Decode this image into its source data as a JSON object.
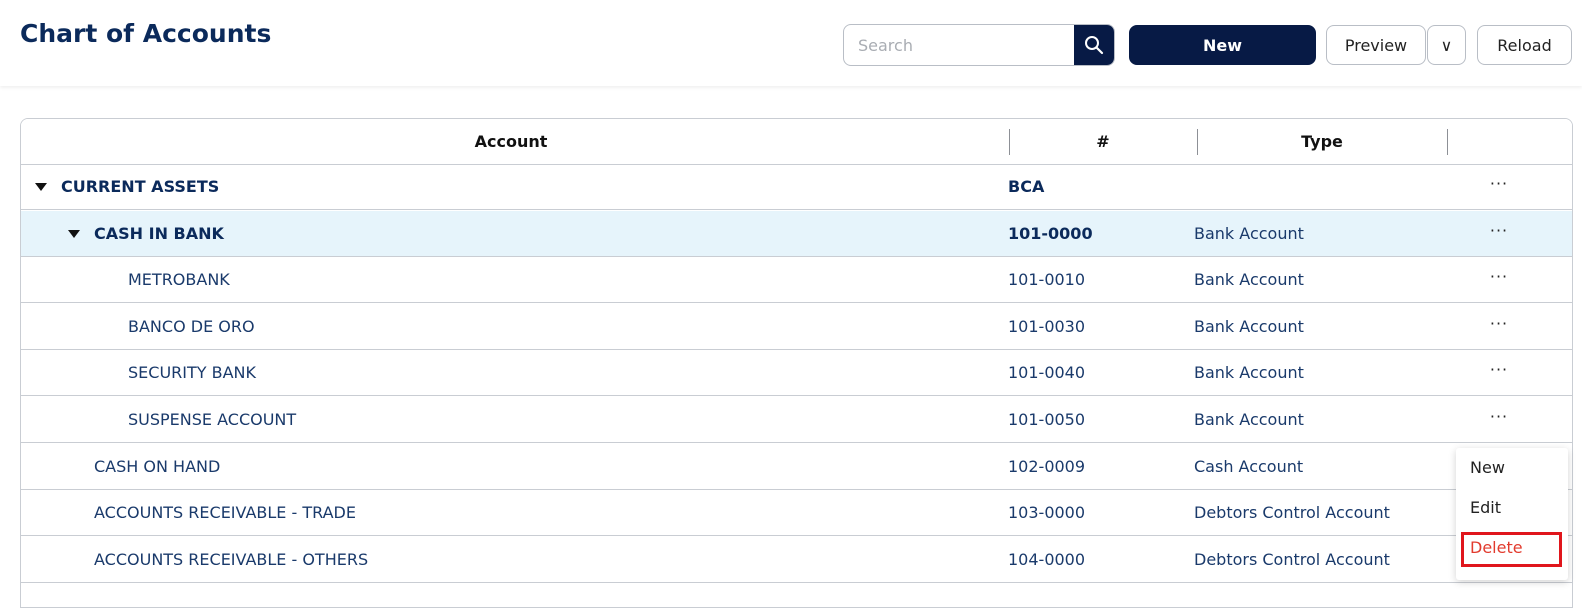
{
  "header": {
    "title": "Chart of Accounts",
    "search_placeholder": "Search",
    "search_value": "",
    "new_label": "New",
    "preview_label": "Preview",
    "dropdown_glyph": "∨",
    "reload_label": "Reload"
  },
  "table": {
    "columns": {
      "account": "Account",
      "number": "#",
      "type": "Type"
    },
    "rows": [
      {
        "account": "CURRENT ASSETS",
        "number": "BCA",
        "type": "",
        "level": 0,
        "expanded": true,
        "bold": true,
        "highlight": false
      },
      {
        "account": "CASH IN BANK",
        "number": "101-0000",
        "type": "Bank Account",
        "level": 1,
        "expanded": true,
        "bold": true,
        "highlight": true
      },
      {
        "account": "METROBANK",
        "number": "101-0010",
        "type": "Bank Account",
        "level": 2,
        "bold": false,
        "highlight": false
      },
      {
        "account": "BANCO DE ORO",
        "number": "101-0030",
        "type": "Bank Account",
        "level": 2,
        "bold": false,
        "highlight": false
      },
      {
        "account": "SECURITY BANK",
        "number": "101-0040",
        "type": "Bank Account",
        "level": 2,
        "bold": false,
        "highlight": false
      },
      {
        "account": "SUSPENSE ACCOUNT",
        "number": "101-0050",
        "type": "Bank Account",
        "level": 2,
        "bold": false,
        "highlight": false
      },
      {
        "account": "CASH ON HAND",
        "number": "102-0009",
        "type": "Cash Account",
        "level": 1,
        "bold": false,
        "highlight": false
      },
      {
        "account": "ACCOUNTS RECEIVABLE - TRADE",
        "number": "103-0000",
        "type": "Debtors Control Account",
        "level": 1,
        "bold": false,
        "highlight": false
      },
      {
        "account": "ACCOUNTS RECEIVABLE - OTHERS",
        "number": "104-0000",
        "type": "Debtors Control Account",
        "level": 1,
        "bold": false,
        "highlight": false
      }
    ],
    "row_actions_glyph": "···"
  },
  "context_menu": {
    "items": [
      "New",
      "Edit",
      "Delete"
    ]
  },
  "colors": {
    "primary": "#071a45",
    "highlight_row": "#e6f4fb",
    "delete_text": "#e23b2e",
    "annotation_box": "#e0161c"
  },
  "icons": {
    "search": "search-icon",
    "row_expand": "caret-down-icon",
    "row_actions": "more-horizontal-icon"
  }
}
